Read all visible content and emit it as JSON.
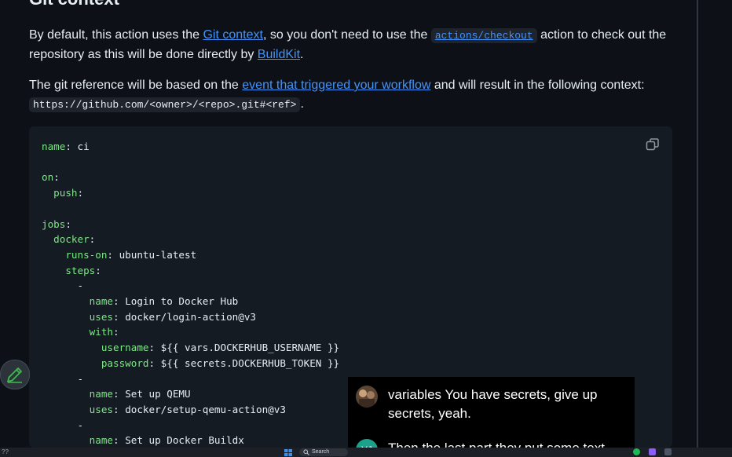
{
  "section": {
    "heading": "Git context"
  },
  "para1": {
    "t1": "By default, this action uses the ",
    "link_git_context": "Git context",
    "t2": ", so you don't need to use the ",
    "code_checkout": "actions/checkout",
    "t3": " action to check out the repository as this will be done directly by ",
    "link_buildkit": "BuildKit",
    "t4": "."
  },
  "para2": {
    "t1": "The git reference will be based on the ",
    "link_event": "event that triggered your workflow",
    "t2": " and will result in the following context: ",
    "code_context": "https://github.com/<owner>/<repo>.git#<ref>",
    "t3": "."
  },
  "code": {
    "copy_icon": "copy-icon",
    "lines": [
      {
        "indent": "",
        "key": "name",
        "sep": ": ",
        "value": "ci"
      },
      {
        "indent": "",
        "key": "",
        "sep": "",
        "value": ""
      },
      {
        "indent": "",
        "key": "on",
        "sep": ":",
        "value": ""
      },
      {
        "indent": "  ",
        "key": "push",
        "sep": ":",
        "value": ""
      },
      {
        "indent": "",
        "key": "",
        "sep": "",
        "value": ""
      },
      {
        "indent": "",
        "key": "jobs",
        "sep": ":",
        "value": ""
      },
      {
        "indent": "  ",
        "key": "docker",
        "sep": ":",
        "value": ""
      },
      {
        "indent": "    ",
        "key": "runs-on",
        "sep": ": ",
        "value": "ubuntu-latest"
      },
      {
        "indent": "    ",
        "key": "steps",
        "sep": ":",
        "value": ""
      },
      {
        "indent": "      ",
        "key": "",
        "sep": "",
        "value": "-"
      },
      {
        "indent": "        ",
        "key": "name",
        "sep": ": ",
        "value": "Login to Docker Hub"
      },
      {
        "indent": "        ",
        "key": "uses",
        "sep": ": ",
        "value": "docker/login-action@v3"
      },
      {
        "indent": "        ",
        "key": "with",
        "sep": ":",
        "value": ""
      },
      {
        "indent": "          ",
        "key": "username",
        "sep": ": ",
        "value": "${{ vars.DOCKERHUB_USERNAME }}"
      },
      {
        "indent": "          ",
        "key": "password",
        "sep": ": ",
        "value": "${{ secrets.DOCKERHUB_TOKEN }}"
      },
      {
        "indent": "      ",
        "key": "",
        "sep": "",
        "value": "-"
      },
      {
        "indent": "        ",
        "key": "name",
        "sep": ": ",
        "value": "Set up QEMU"
      },
      {
        "indent": "        ",
        "key": "uses",
        "sep": ": ",
        "value": "docker/setup-qemu-action@v3"
      },
      {
        "indent": "      ",
        "key": "",
        "sep": "",
        "value": "-"
      },
      {
        "indent": "        ",
        "key": "name",
        "sep": ": ",
        "value": "Set up Docker Buildx"
      }
    ]
  },
  "captions": [
    {
      "avatar": "user-photo-avatar",
      "text": "variables You have secrets, give up secrets, yeah."
    },
    {
      "avatar_initials": "YJ",
      "avatar_color": "#1aa38a",
      "text": "Then the last part they put some text"
    }
  ],
  "taskbar": {
    "search_label": "Search",
    "left_text": "??"
  },
  "colors": {
    "background": "#0d1117",
    "link": "#4493f8",
    "yaml_key": "#7ee787",
    "code_bg": "#151b23"
  }
}
